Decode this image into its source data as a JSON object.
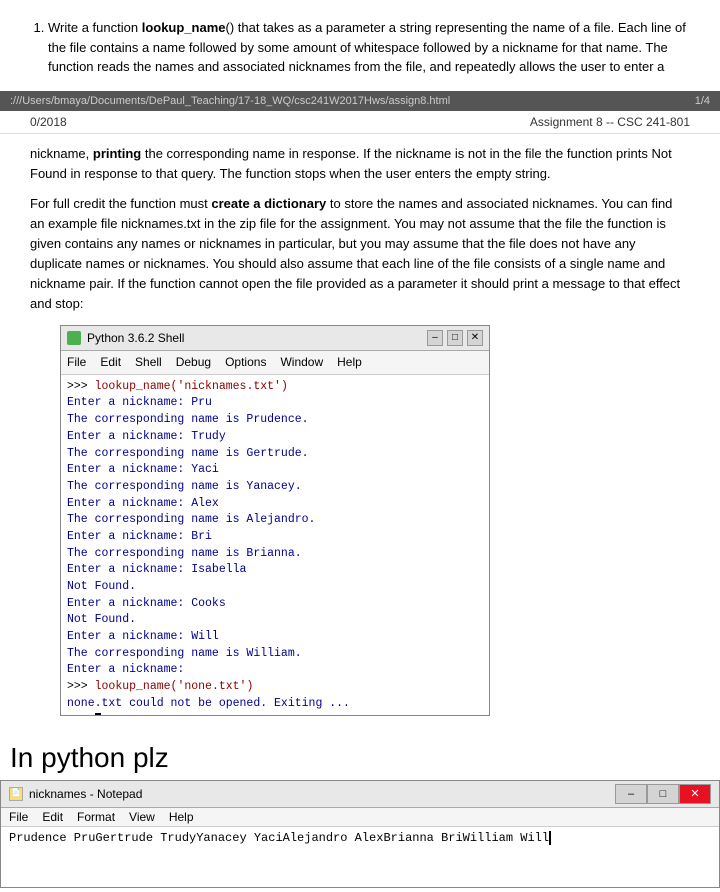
{
  "instruction": {
    "number": "1.",
    "text": "Write a function ",
    "function_name": "lookup_name",
    "text2": "() that takes as a parameter a string representing the name of a file. Each line of the file contains a name followed by some amount of whitespace followed by a nickname for that name. The function reads the names and associated nicknames from the file, and repeatedly allows the user to enter a"
  },
  "url_bar": {
    "path": ":///Users/bmaya/Documents/DePaul_Teaching/17-18_WQ/csc241W2017Hws/assign8.html",
    "page": "1/4"
  },
  "page_header": {
    "date": "0/2018",
    "title": "Assignment 8 -- CSC 241-801"
  },
  "body_text_1": "nickname, ",
  "body_bold_1": "printing",
  "body_text_1b": " the corresponding name in response. If the nickname is not in the file the function prints Not Found in response to that query. The function stops when the user enters the empty string.",
  "body_text_2": "For full credit the function must ",
  "body_bold_2": "create a dictionary",
  "body_text_2b": " to store the names and associated nicknames. You can find an example file nicknames.txt in the zip file for the assignment. You may not assume that the file the function is given contains any names or nicknames in particular, but you may assume that the file does not have any duplicate names or nicknames. You should also assume that each line of the file consists of a single name and nickname pair. If the function cannot open the file provided as a parameter it should print a message to that effect and stop:",
  "shell": {
    "title": "Python 3.6.2 Shell",
    "menu_items": [
      "File",
      "Edit",
      "Shell",
      "Debug",
      "Options",
      "Window",
      "Help"
    ],
    "lines": [
      {
        "type": "prompt",
        "text": ">>> ",
        "content": "lookup_name('nicknames.txt')"
      },
      {
        "type": "output",
        "text": "Enter a nickname: Pru"
      },
      {
        "type": "output",
        "text": "The corresponding name is Prudence."
      },
      {
        "type": "output",
        "text": "Enter a nickname: Trudy"
      },
      {
        "type": "output",
        "text": "The corresponding name is Gertrude."
      },
      {
        "type": "output",
        "text": "Enter a nickname: Yaci"
      },
      {
        "type": "output",
        "text": "The corresponding name is Yanacey."
      },
      {
        "type": "output",
        "text": "Enter a nickname: Alex"
      },
      {
        "type": "output",
        "text": "The corresponding name is Alejandro."
      },
      {
        "type": "output",
        "text": "Enter a nickname: Bri"
      },
      {
        "type": "output",
        "text": "The corresponding name is Brianna."
      },
      {
        "type": "output",
        "text": "Enter a nickname: Isabella"
      },
      {
        "type": "notfound",
        "text": "Not Found."
      },
      {
        "type": "output",
        "text": "Enter a nickname: Cooks"
      },
      {
        "type": "notfound",
        "text": "Not Found."
      },
      {
        "type": "output",
        "text": "Enter a nickname: Will"
      },
      {
        "type": "output",
        "text": "The corresponding name is William."
      },
      {
        "type": "output",
        "text": "Enter a nickname: "
      },
      {
        "type": "prompt2",
        "text": ">>> ",
        "content": "lookup_name('none.txt')"
      },
      {
        "type": "output",
        "text": "none.txt could not be opened. Exiting ..."
      },
      {
        "type": "prompt3",
        "text": ">>> "
      }
    ]
  },
  "in_python_label": "In python plz",
  "notepad": {
    "title": "nicknames - Notepad",
    "menu_items": [
      "File",
      "Edit",
      "Format",
      "View",
      "Help"
    ],
    "content": "Prudence    PruGertrude    TrudyYanacey    YaciAlejandro    AlexBrianna    BriWilliam    Will"
  }
}
